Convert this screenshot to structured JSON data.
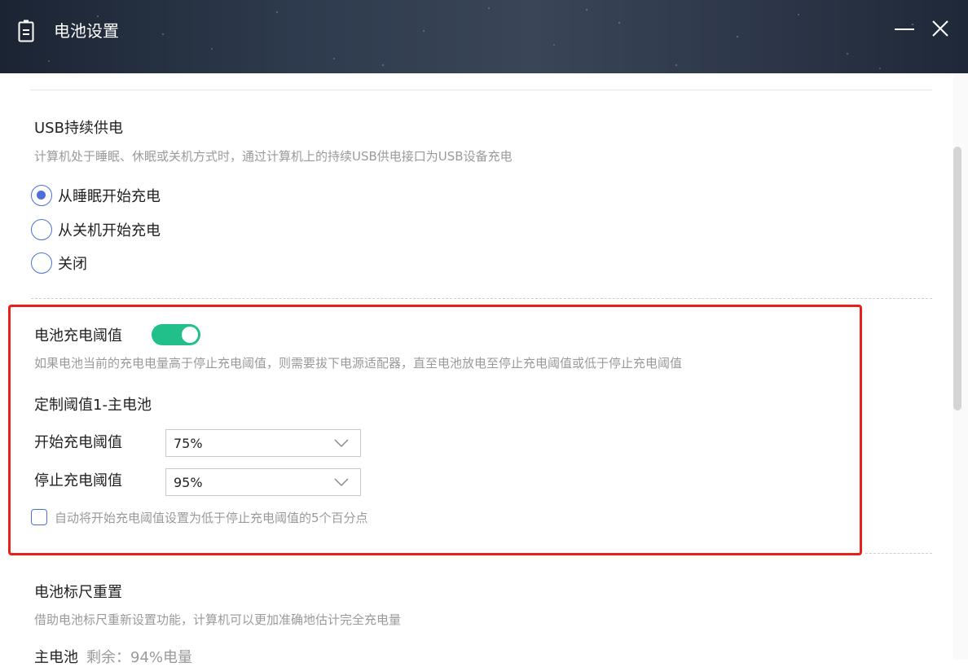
{
  "window": {
    "title": "电池设置",
    "battery_icon": "battery-icon",
    "minimize_icon": "minimize-icon",
    "close_icon": "close-icon"
  },
  "usb_section": {
    "title": "USB持续供电",
    "description": "计算机处于睡眠、休眠或关机方式时，通过计算机上的持续USB供电接口为USB设备充电",
    "options": [
      {
        "label": "从睡眠开始充电",
        "checked": true
      },
      {
        "label": "从关机开始充电",
        "checked": false
      },
      {
        "label": "关闭",
        "checked": false
      }
    ]
  },
  "threshold_section": {
    "title": "电池充电阈值",
    "toggle_on": true,
    "description": "如果电池当前的充电电量高于停止充电阈值，则需要拔下电源适配器，直至电池放电至停止充电阈值或低于停止充电阈值",
    "custom_title": "定制阈值1-主电池",
    "start_label": "开始充电阈值",
    "start_value": "75%",
    "stop_label": "停止充电阈值",
    "stop_value": "95%",
    "auto_checkbox_label": "自动将开始充电阈值设置为低于停止充电阈值的5个百分点",
    "auto_checked": false
  },
  "gauge_section": {
    "title": "电池标尺重置",
    "description": "借助电池标尺重新设置功能，计算机可以更加准确地估计完全充电量",
    "main_battery_label": "主电池",
    "main_battery_status": "剩余：94%电量"
  },
  "colors": {
    "accent_blue": "#4a72d6",
    "toggle_green": "#21c08a",
    "highlight_red": "#e8201c",
    "muted_text": "#9a9a9a"
  }
}
